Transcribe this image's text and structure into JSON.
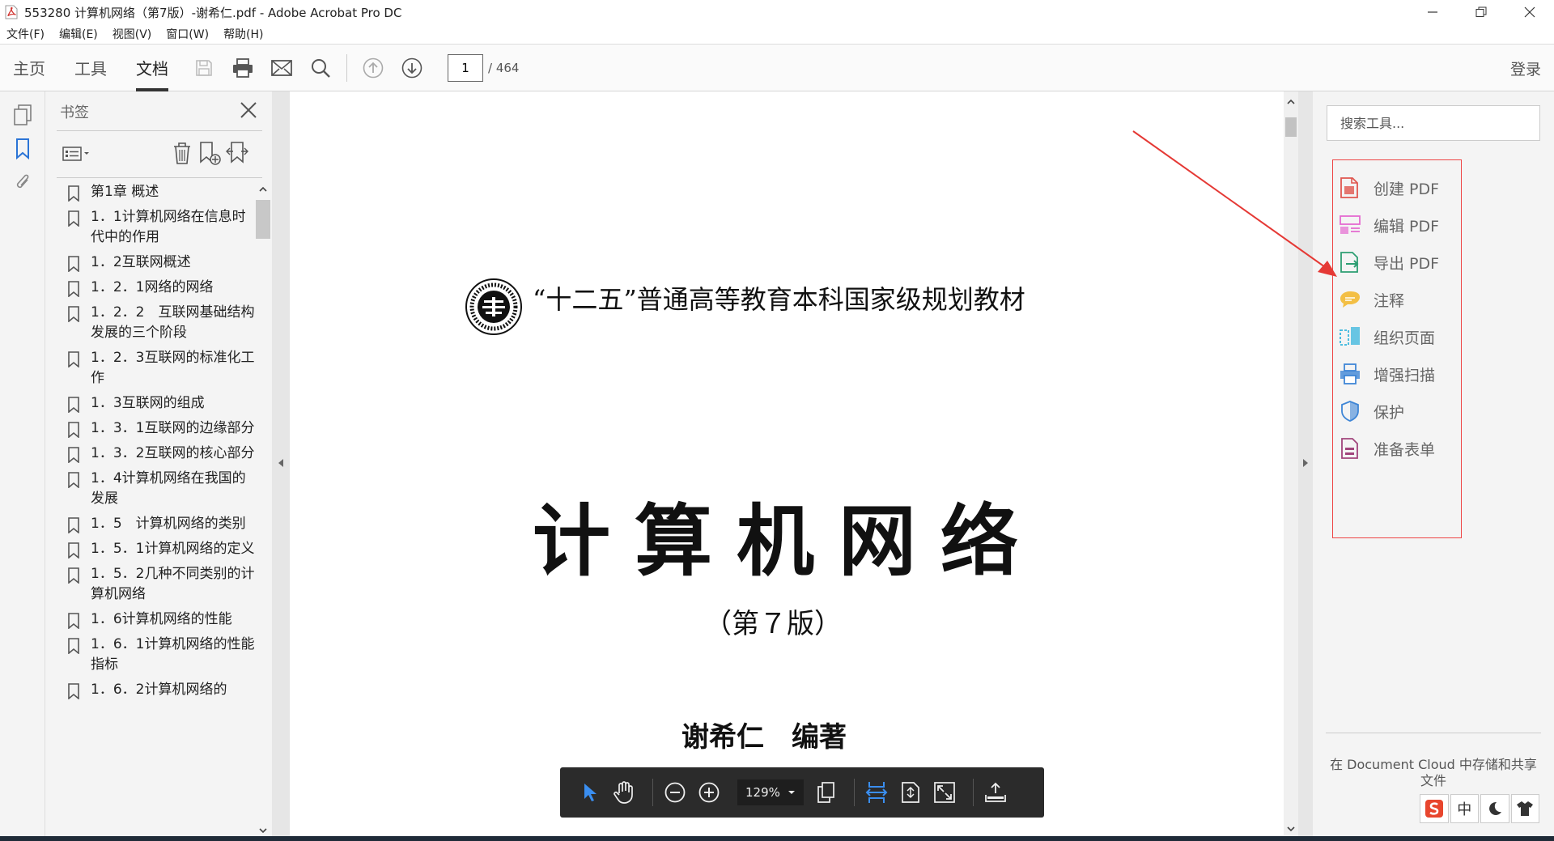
{
  "window": {
    "title": "553280 计算机网络（第7版）-谢希仁.pdf - Adobe Acrobat Pro DC",
    "controls": {
      "minimize": "—",
      "restore": "❐",
      "close": "✕"
    }
  },
  "menu": [
    "文件(F)",
    "编辑(E)",
    "视图(V)",
    "窗口(W)",
    "帮助(H)"
  ],
  "toolbar": {
    "tabs": [
      "主页",
      "工具",
      "文档"
    ],
    "active_tab": "文档",
    "page_current": "1",
    "page_total": "/ 464",
    "login": "登录"
  },
  "bookmarks": {
    "title": "书签",
    "items": [
      "第1章 概述",
      "1．1计算机网络在信息时代中的作用",
      "1．2互联网概述",
      "1．2．1网络的网络",
      "1．2．2　互联网基础结构发展的三个阶段",
      "1．2．3互联网的标准化工作",
      "1．3互联网的组成",
      "1．3．1互联网的边缘部分",
      "1．3．2互联网的核心部分",
      "1．4计算机网络在我国的发展",
      "1．5　计算机网络的类别",
      "1．5．1计算机网络的定义",
      "1．5．2几种不同类别的计算机网络",
      "1．6计算机网络的性能",
      "1．6．1计算机网络的性能指标",
      "1．6．2计算机网络的"
    ]
  },
  "document": {
    "series": "“十二五”普通高等教育本科国家级规划教材",
    "main_title": "计算机网络",
    "edition": "（第７版）",
    "author": "谢希仁　编著"
  },
  "floating_toolbar": {
    "zoom": "129%"
  },
  "tools_panel": {
    "search_placeholder": "搜索工具...",
    "tools": [
      {
        "label": "创建 PDF",
        "icon": "create-pdf-icon",
        "color": "#e0574f"
      },
      {
        "label": "编辑 PDF",
        "icon": "edit-pdf-icon",
        "color": "#e46ad0"
      },
      {
        "label": "导出 PDF",
        "icon": "export-pdf-icon",
        "color": "#2d9e72"
      },
      {
        "label": "注释",
        "icon": "comment-icon",
        "color": "#f2b526"
      },
      {
        "label": "组织页面",
        "icon": "organize-pages-icon",
        "color": "#38b6dd"
      },
      {
        "label": "增强扫描",
        "icon": "enhance-scan-icon",
        "color": "#3f86d6"
      },
      {
        "label": "保护",
        "icon": "protect-icon",
        "color": "#3f86d6"
      },
      {
        "label": "准备表单",
        "icon": "prepare-form-icon",
        "color": "#a1457c"
      }
    ],
    "cloud_text": "在 Document Cloud 中存储和共享文件"
  },
  "ime": {
    "lang": "中"
  }
}
